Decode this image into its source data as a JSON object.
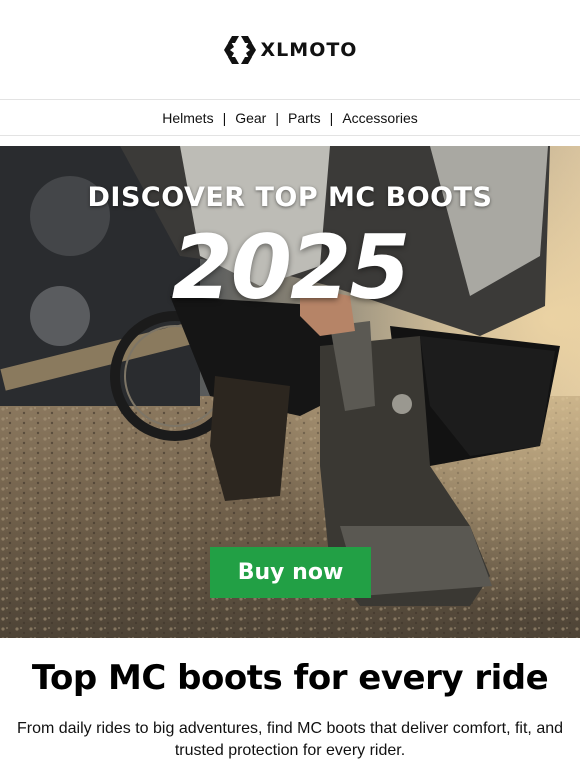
{
  "brand": {
    "name": "XLMOTO",
    "logo_icon": "xlmoto-logo-icon"
  },
  "nav": {
    "items": [
      {
        "label": "Helmets"
      },
      {
        "label": "Gear"
      },
      {
        "label": "Parts"
      },
      {
        "label": "Accessories"
      }
    ],
    "separator": "|"
  },
  "hero": {
    "title": "DISCOVER TOP MC BOOTS",
    "year": "2025",
    "cta_label": "Buy now",
    "image": "rider-fastening-motorcycle-boot-photo"
  },
  "content": {
    "headline": "Top MC boots for every ride",
    "body": "From daily rides to big adventures, find MC boots that deliver comfort, fit, and trusted protection for every rider."
  },
  "colors": {
    "cta": "#22a045",
    "text": "#111111",
    "background": "#ffffff"
  }
}
